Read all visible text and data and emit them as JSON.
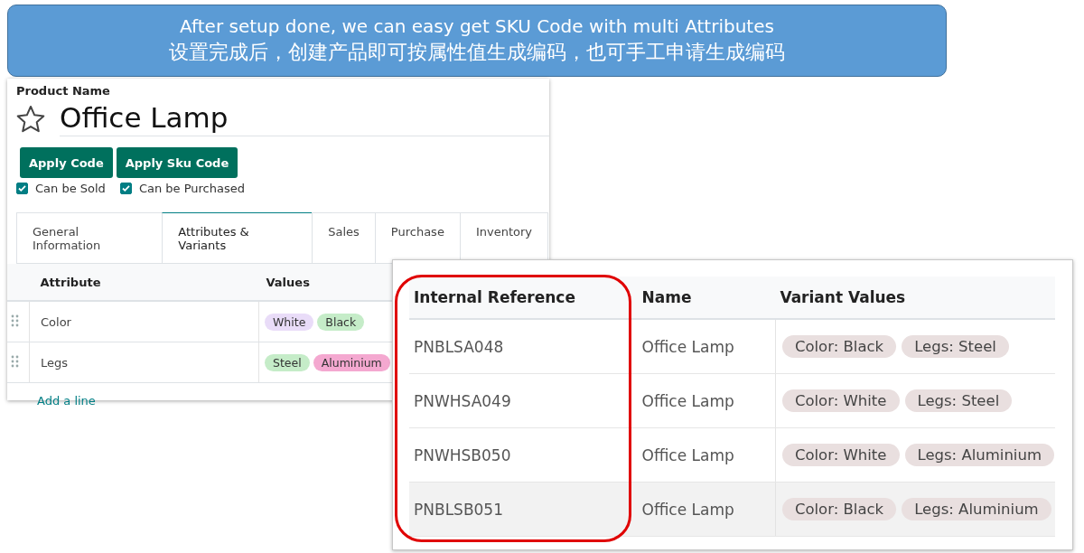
{
  "banner": {
    "lines": [
      "After setup done,  we can easy get SKU Code with multi Attributes",
      "设置完成后，创建产品即可按属性值生成编码，也可手工申请生成编码"
    ]
  },
  "product_form": {
    "field_label": "Product Name",
    "favorite": false,
    "name": "Office Lamp",
    "buttons": [
      "Apply Code",
      "Apply Sku Code"
    ],
    "checkboxes": [
      {
        "label": "Can be Sold",
        "checked": true
      },
      {
        "label": "Can be Purchased",
        "checked": true
      }
    ],
    "tabs": [
      {
        "label": "General Information",
        "selected": false
      },
      {
        "label": "Attributes & Variants",
        "selected": true
      },
      {
        "label": "Sales",
        "selected": false
      },
      {
        "label": "Purchase",
        "selected": false
      },
      {
        "label": "Inventory",
        "selected": false
      }
    ],
    "attribute_table": {
      "columns": [
        "Attribute",
        "Values"
      ],
      "rows": [
        {
          "attribute": "Color",
          "values": [
            {
              "label": "White",
              "color": "#e9dcf8"
            },
            {
              "label": "Black",
              "color": "#c5ecc8"
            }
          ]
        },
        {
          "attribute": "Legs",
          "values": [
            {
              "label": "Steel",
              "color": "#c5ecc8"
            },
            {
              "label": "Aluminium",
              "color": "#f4a8d0"
            }
          ]
        }
      ],
      "add_line": "Add a line"
    }
  },
  "variant_table": {
    "columns": [
      "Internal Reference",
      "Name",
      "Variant Values"
    ],
    "highlighted_column": true,
    "rows": [
      {
        "reference": "PNBLSA048",
        "name": "Office Lamp",
        "values": [
          "Color: Black",
          "Legs: Steel"
        ],
        "selected": false
      },
      {
        "reference": "PNWHSA049",
        "name": "Office Lamp",
        "values": [
          "Color: White",
          "Legs: Steel"
        ],
        "selected": false
      },
      {
        "reference": "PNWHSB050",
        "name": "Office Lamp",
        "values": [
          "Color: White",
          "Legs: Aluminium"
        ],
        "selected": false
      },
      {
        "reference": "PNBLSB051",
        "name": "Office Lamp",
        "values": [
          "Color: Black",
          "Legs: Aluminium"
        ],
        "selected": true
      }
    ]
  }
}
